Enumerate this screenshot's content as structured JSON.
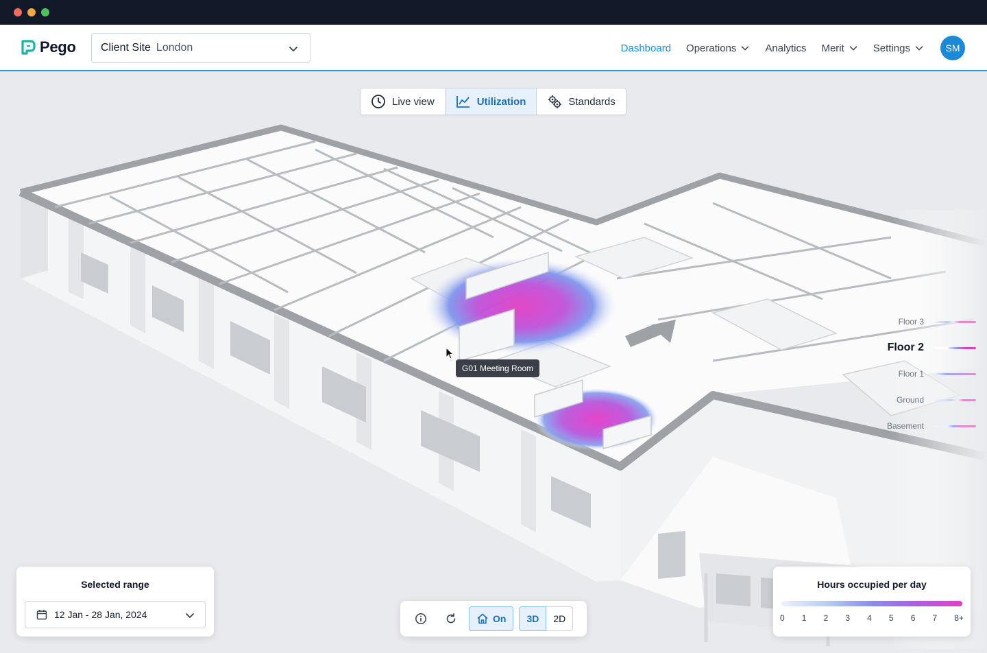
{
  "brand": {
    "name": "Pego"
  },
  "site": {
    "label": "Client Site",
    "value": "London"
  },
  "nav": {
    "items": [
      {
        "label": "Dashboard",
        "active": true,
        "dropdown": false
      },
      {
        "label": "Operations",
        "active": false,
        "dropdown": true
      },
      {
        "label": "Analytics",
        "active": false,
        "dropdown": false
      },
      {
        "label": "Merit",
        "active": false,
        "dropdown": true
      },
      {
        "label": "Settings",
        "active": false,
        "dropdown": true
      }
    ],
    "avatar": "SM"
  },
  "view_modes": [
    {
      "label": "Live view",
      "icon": "clock-icon",
      "active": false
    },
    {
      "label": "Utilization",
      "icon": "line-chart-icon",
      "active": true
    },
    {
      "label": "Standards",
      "icon": "gears-icon",
      "active": false
    }
  ],
  "tooltip": {
    "text": "G01 Meeting Room"
  },
  "floors": [
    {
      "label": "Floor 3",
      "active": false
    },
    {
      "label": "Floor 2",
      "active": true
    },
    {
      "label": "Floor 1",
      "active": false
    },
    {
      "label": "Ground",
      "active": false
    },
    {
      "label": "Basement",
      "active": false
    }
  ],
  "range": {
    "title": "Selected range",
    "value": "12 Jan - 28 Jan, 2024"
  },
  "controls": {
    "home_label": "On",
    "mode_3d": "3D",
    "mode_2d": "2D"
  },
  "legend": {
    "title": "Hours occupied per day",
    "ticks": [
      "0",
      "1",
      "2",
      "3",
      "4",
      "5",
      "6",
      "7",
      "8+"
    ]
  },
  "colors": {
    "accent": "#1a8ad8",
    "heat_low": "#b9cdf2",
    "heat_high": "#e03fc4"
  }
}
